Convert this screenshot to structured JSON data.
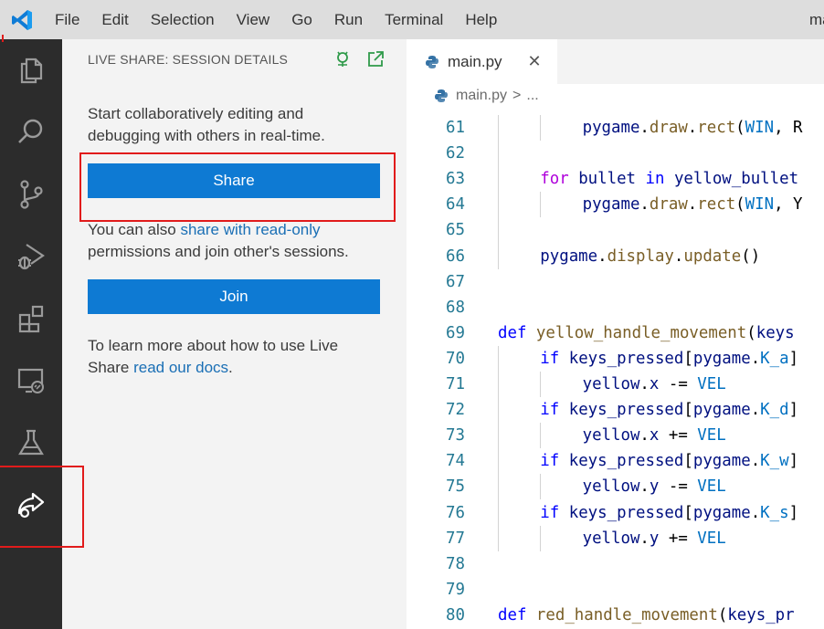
{
  "titlebar": {
    "menu": [
      "File",
      "Edit",
      "Selection",
      "View",
      "Go",
      "Run",
      "Terminal",
      "Help"
    ],
    "title": "ma"
  },
  "activitybar": {
    "icons": [
      "explorer-icon",
      "search-icon",
      "source-control-icon",
      "run-debug-icon",
      "extensions-icon",
      "remote-explorer-icon",
      "testing-icon",
      "live-share-icon"
    ]
  },
  "sidebar": {
    "header": "LIVE SHARE: SESSION DETAILS",
    "intro": "Start collaboratively editing and debugging with others in real-time.",
    "share_button": "Share",
    "also_prefix": "You can also ",
    "also_link": "share with read-only",
    "also_suffix": " permissions and join other's sessions.",
    "join_button": "Join",
    "learn_prefix": "To learn more about how to use Live Share ",
    "learn_link": "read our docs",
    "learn_suffix": "."
  },
  "editor": {
    "tab_label": "main.py",
    "tab_close": "✕",
    "breadcrumb_file": "main.py",
    "breadcrumb_sep": ">",
    "breadcrumb_more": "...",
    "lines": [
      {
        "n": "61",
        "indent": 2,
        "tokens": [
          [
            "id",
            "pygame"
          ],
          [
            "",
            "."
          ],
          [
            "fn",
            "draw"
          ],
          [
            "",
            "."
          ],
          [
            "fn",
            "rect"
          ],
          [
            "",
            "("
          ],
          [
            "cst",
            "WIN"
          ],
          [
            "",
            ", R"
          ]
        ]
      },
      {
        "n": "62",
        "indent": 0,
        "tokens": []
      },
      {
        "n": "63",
        "indent": 1,
        "tokens": [
          [
            "kw2",
            "for"
          ],
          [
            "",
            " "
          ],
          [
            "id",
            "bullet"
          ],
          [
            "",
            " "
          ],
          [
            "k",
            "in"
          ],
          [
            "",
            " "
          ],
          [
            "id",
            "yellow_bullet"
          ]
        ]
      },
      {
        "n": "64",
        "indent": 2,
        "tokens": [
          [
            "id",
            "pygame"
          ],
          [
            "",
            "."
          ],
          [
            "fn",
            "draw"
          ],
          [
            "",
            "."
          ],
          [
            "fn",
            "rect"
          ],
          [
            "",
            "("
          ],
          [
            "cst",
            "WIN"
          ],
          [
            "",
            ", Y"
          ]
        ]
      },
      {
        "n": "65",
        "indent": 0,
        "tokens": []
      },
      {
        "n": "66",
        "indent": 1,
        "tokens": [
          [
            "id",
            "pygame"
          ],
          [
            "",
            "."
          ],
          [
            "fn",
            "display"
          ],
          [
            "",
            "."
          ],
          [
            "fn",
            "update"
          ],
          [
            "",
            "()"
          ]
        ]
      },
      {
        "n": "67",
        "indent": 0,
        "tokens": []
      },
      {
        "n": "68",
        "indent": 0,
        "tokens": []
      },
      {
        "n": "69",
        "indent": 0,
        "tokens": [
          [
            "k",
            "def"
          ],
          [
            "",
            " "
          ],
          [
            "fn",
            "yellow_handle_movement"
          ],
          [
            "",
            "("
          ],
          [
            "id",
            "keys"
          ]
        ]
      },
      {
        "n": "70",
        "indent": 1,
        "tokens": [
          [
            "k",
            "if"
          ],
          [
            "",
            " "
          ],
          [
            "id",
            "keys_pressed"
          ],
          [
            "",
            "["
          ],
          [
            "id",
            "pygame"
          ],
          [
            "",
            "."
          ],
          [
            "cst",
            "K_a"
          ],
          [
            "",
            "]"
          ]
        ]
      },
      {
        "n": "71",
        "indent": 2,
        "tokens": [
          [
            "id",
            "yellow"
          ],
          [
            "",
            "."
          ],
          [
            "id",
            "x"
          ],
          [
            "",
            " -= "
          ],
          [
            "cst",
            "VEL"
          ]
        ]
      },
      {
        "n": "72",
        "indent": 1,
        "tokens": [
          [
            "k",
            "if"
          ],
          [
            "",
            " "
          ],
          [
            "id",
            "keys_pressed"
          ],
          [
            "",
            "["
          ],
          [
            "id",
            "pygame"
          ],
          [
            "",
            "."
          ],
          [
            "cst",
            "K_d"
          ],
          [
            "",
            "]"
          ]
        ]
      },
      {
        "n": "73",
        "indent": 2,
        "tokens": [
          [
            "id",
            "yellow"
          ],
          [
            "",
            "."
          ],
          [
            "id",
            "x"
          ],
          [
            "",
            " += "
          ],
          [
            "cst",
            "VEL"
          ]
        ]
      },
      {
        "n": "74",
        "indent": 1,
        "tokens": [
          [
            "k",
            "if"
          ],
          [
            "",
            " "
          ],
          [
            "id",
            "keys_pressed"
          ],
          [
            "",
            "["
          ],
          [
            "id",
            "pygame"
          ],
          [
            "",
            "."
          ],
          [
            "cst",
            "K_w"
          ],
          [
            "",
            "]"
          ]
        ]
      },
      {
        "n": "75",
        "indent": 2,
        "tokens": [
          [
            "id",
            "yellow"
          ],
          [
            "",
            "."
          ],
          [
            "id",
            "y"
          ],
          [
            "",
            " -= "
          ],
          [
            "cst",
            "VEL"
          ]
        ]
      },
      {
        "n": "76",
        "indent": 1,
        "tokens": [
          [
            "k",
            "if"
          ],
          [
            "",
            " "
          ],
          [
            "id",
            "keys_pressed"
          ],
          [
            "",
            "["
          ],
          [
            "id",
            "pygame"
          ],
          [
            "",
            "."
          ],
          [
            "cst",
            "K_s"
          ],
          [
            "",
            "]"
          ]
        ]
      },
      {
        "n": "77",
        "indent": 2,
        "tokens": [
          [
            "id",
            "yellow"
          ],
          [
            "",
            "."
          ],
          [
            "id",
            "y"
          ],
          [
            "",
            " += "
          ],
          [
            "cst",
            "VEL"
          ]
        ]
      },
      {
        "n": "78",
        "indent": 0,
        "tokens": []
      },
      {
        "n": "79",
        "indent": 0,
        "tokens": []
      },
      {
        "n": "80",
        "indent": 0,
        "tokens": [
          [
            "k",
            "def"
          ],
          [
            "",
            " "
          ],
          [
            "fn",
            "red_handle_movement"
          ],
          [
            "",
            "("
          ],
          [
            "id",
            "keys_pr"
          ]
        ]
      }
    ]
  },
  "colors": {
    "accent_button": "#0e7ad3",
    "highlight": "#e11b1b",
    "link": "#1a6fb5"
  }
}
